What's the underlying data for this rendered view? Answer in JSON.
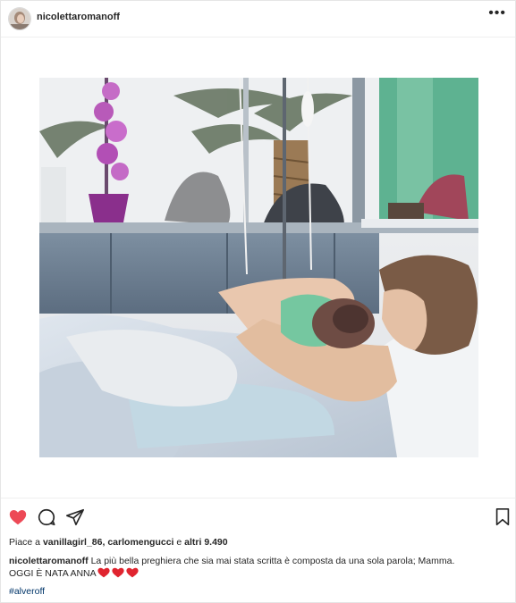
{
  "post": {
    "username": "nicolettaromanoff",
    "more_icon": "more-horizontal-icon",
    "photo_description": "hospital-bed-newborn-photo"
  },
  "actions": {
    "like_icon": "heart-filled-icon",
    "comment_icon": "comment-icon",
    "share_icon": "share-icon",
    "save_icon": "bookmark-icon",
    "like_color": "#ed4956"
  },
  "likes": {
    "prefix": "Piace a ",
    "user1": "vanillagirl_86",
    "sep": ", ",
    "user2": "carlomengucci",
    "middle": " e ",
    "others": "altri 9.490"
  },
  "caption": {
    "username": "nicolettaromanoff",
    "text": "La più bella preghiera che sia mai stata scritta è composta da una sola parola; Mamma.",
    "line2": "OGGI È NATA ANNA",
    "emoji": "heart-emoji",
    "emoji_count": 3,
    "hashtag": "#alveroff"
  }
}
